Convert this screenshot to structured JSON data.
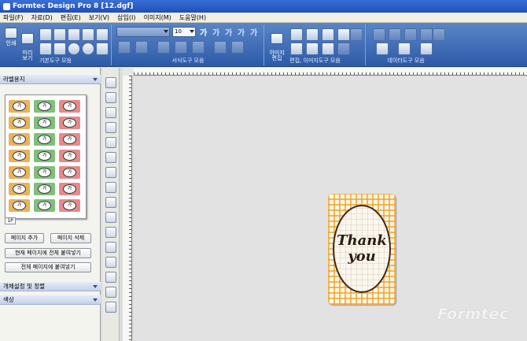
{
  "window": {
    "title": "Formtec Design Pro 8 [12.dgf]"
  },
  "menu": [
    "파일(F)",
    "자료(D)",
    "편집(E)",
    "보기(V)",
    "삽입(I)",
    "이미지(M)",
    "도움말(H)"
  ],
  "ribbon": {
    "groups": {
      "basic": "기본도구 모음",
      "format": "서식도구 모음",
      "edit": "편집, 이미지도구 모음",
      "data": "데이터도구 모음"
    },
    "print_label": "인쇄",
    "preview_label": "미리\n보기",
    "image_edit_label": "이미지\n편집",
    "font_size": "10",
    "ga_glyphs": [
      "가",
      "가",
      "가",
      "가",
      "가"
    ]
  },
  "left_panel": {
    "label_paper_header": "라벨용지",
    "page_tab": "1P",
    "thumb_label_text": "가",
    "buttons": {
      "add_page": "페이지 추가",
      "delete_page": "페이지 삭제",
      "paste_current": "현재 페이지에 전체 붙여넣기",
      "paste_all": "전체 페이지에 붙여넣기"
    },
    "object_header": "개체설정 및 정렬",
    "color_header": "색상"
  },
  "label_cell_colors": [
    "#e8b35b",
    "#7fc07a",
    "#e68a8a"
  ],
  "card": {
    "line1": "Thank",
    "line2": "you",
    "check_color": "#efa228"
  },
  "watermark": "Formtec"
}
